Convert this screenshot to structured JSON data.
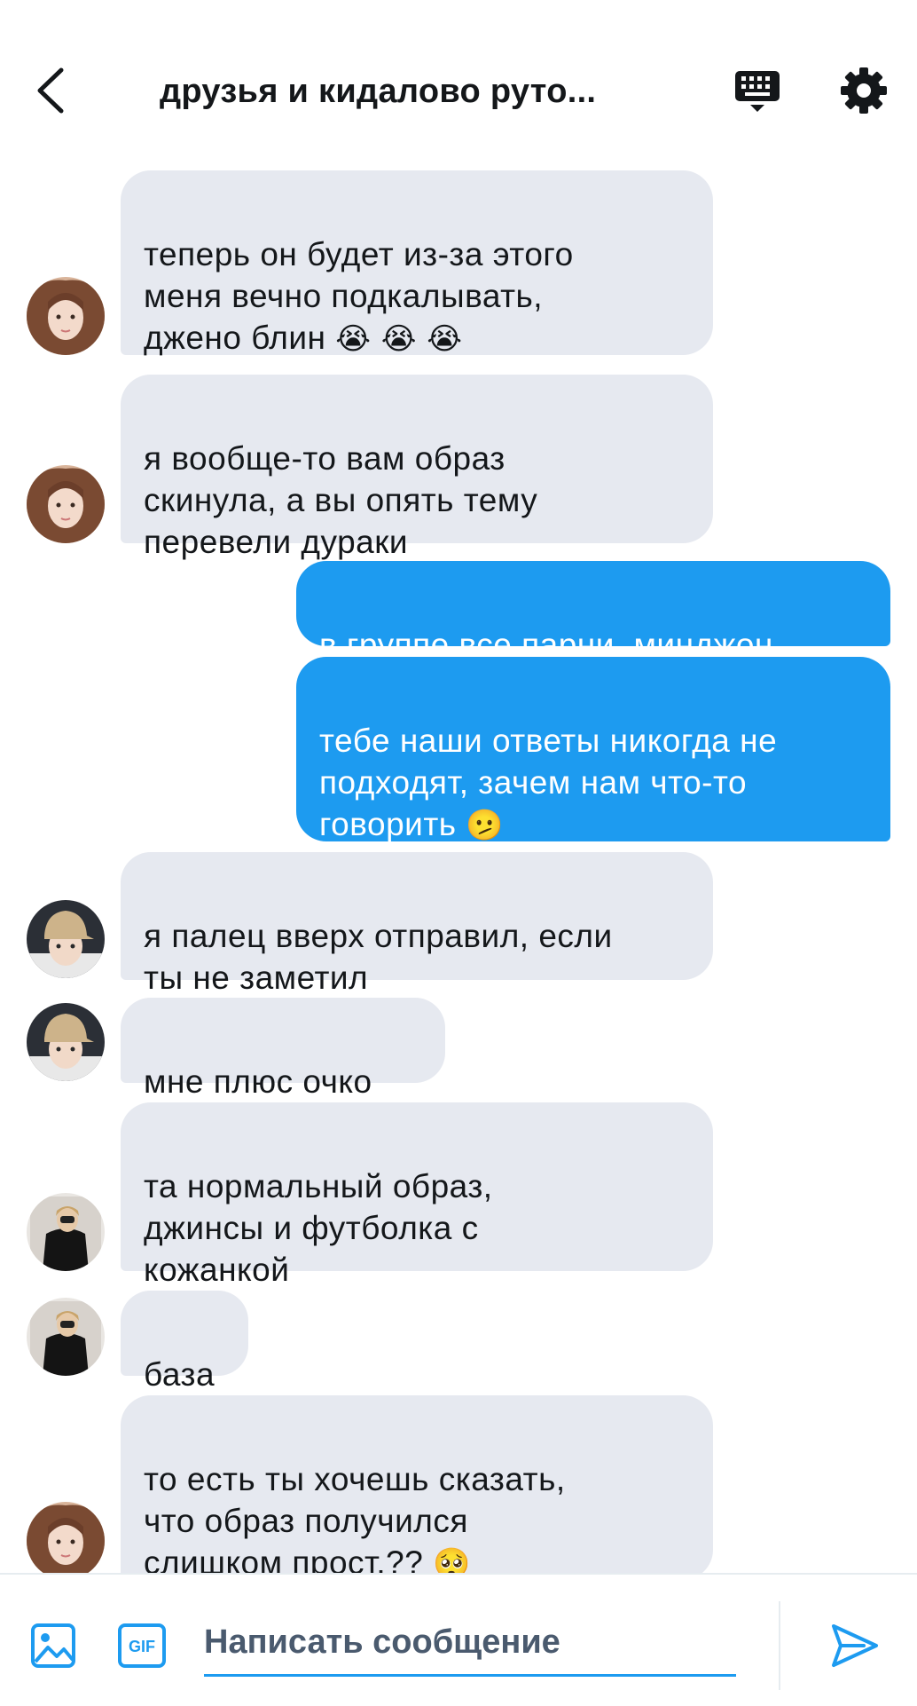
{
  "header": {
    "title": "друзья и кидалово руто...",
    "back_icon": "back-arrow-icon",
    "keyboard_icon": "keyboard-icon",
    "settings_icon": "gear-icon"
  },
  "messages": [
    {
      "direction": "in",
      "text": "теперь он будет из-за этого\nменя вечно подкалывать,\nджено блин",
      "emoji": "😭 😭 😭",
      "avatar": "avatar-girl"
    },
    {
      "direction": "in",
      "text": "я вообще-то вам образ\nскинула, а вы опять тему\nперевели дураки",
      "emoji": "",
      "avatar": "avatar-girl"
    },
    {
      "direction": "out",
      "text": "в группе все парни, минджон",
      "emoji": ""
    },
    {
      "direction": "out",
      "text": "тебе наши ответы никогда не\nподходят, зачем нам что-то\nговорить",
      "emoji": "🫤"
    },
    {
      "direction": "in",
      "text": "я палец вверх отправил, если\nты не заметил",
      "emoji": "",
      "avatar": "avatar-cap"
    },
    {
      "direction": "in",
      "text": "мне плюс очко",
      "emoji": "",
      "avatar": "avatar-cap"
    },
    {
      "direction": "in",
      "text": "та нормальный образ,\nджинсы и футболка с\nкожанкой",
      "emoji": "",
      "avatar": "avatar-dark"
    },
    {
      "direction": "in",
      "text": "база",
      "emoji": "",
      "avatar": "avatar-dark"
    },
    {
      "direction": "in",
      "text": "то есть ты хочешь сказать,\nчто образ получился\nслишком прост.??",
      "emoji": "🥺",
      "avatar": "avatar-girl"
    }
  ],
  "composer": {
    "placeholder": "Написать сообщение",
    "media_icon": "image-icon",
    "gif_label": "GIF",
    "send_icon": "send-icon"
  },
  "colors": {
    "accent": "#1d9bf0",
    "incoming_bubble": "#e6e9f0",
    "text": "#14171a"
  }
}
